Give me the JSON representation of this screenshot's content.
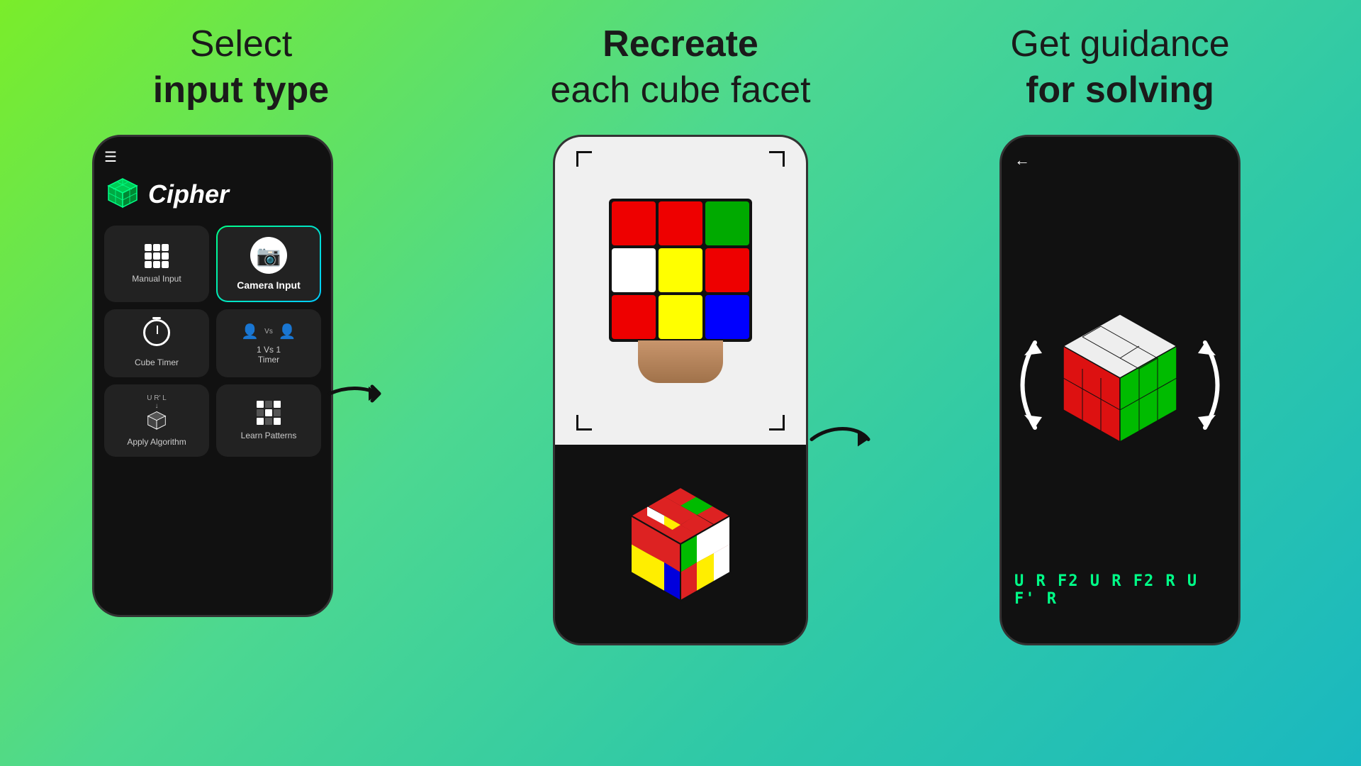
{
  "sections": [
    {
      "id": "select-input",
      "headline_line1": "Select",
      "headline_line2_bold": "input type",
      "phone": {
        "app_name": "Cipher",
        "buttons": [
          {
            "id": "manual-input",
            "label": "Manual Input",
            "icon": "grid"
          },
          {
            "id": "camera-input",
            "label": "Camera Input",
            "icon": "camera",
            "highlighted": true
          },
          {
            "id": "cube-timer",
            "label": "Cube Timer",
            "icon": "timer"
          },
          {
            "id": "1vs1-timer",
            "label": "1 Vs 1\nTimer",
            "icon": "onevone"
          },
          {
            "id": "apply-algo",
            "label": "Apply Algorithm",
            "icon": "algo"
          },
          {
            "id": "learn-patterns",
            "label": "Learn Patterns",
            "icon": "patterns"
          }
        ]
      }
    },
    {
      "id": "recreate-facet",
      "headline_line1": "Recreate",
      "headline_line2": "each cube facet",
      "phone_top_colors": [
        [
          "red",
          "red",
          "green"
        ],
        [
          "white",
          "yellow",
          "red"
        ],
        [
          "red",
          "yellow",
          "blue"
        ]
      ],
      "phone_bottom_label": "3d-cube-render"
    },
    {
      "id": "get-guidance",
      "headline_line1": "Get guidance",
      "headline_line2_bold": "for solving",
      "algo_text": "U R F2 U R F2 R U F' R"
    }
  ]
}
